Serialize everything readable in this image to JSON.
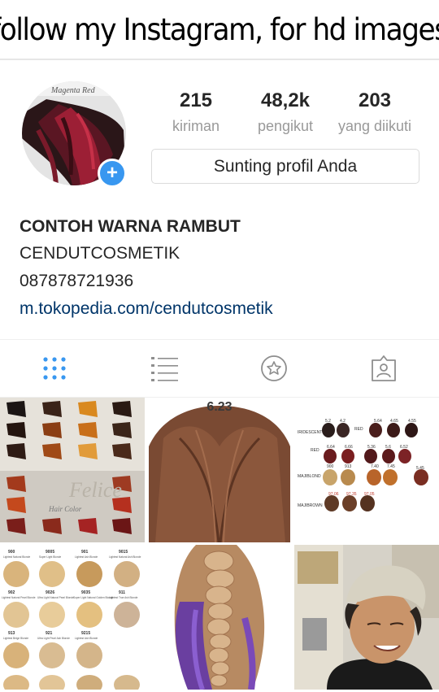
{
  "banner": {
    "text": "follow my Instagram, for hd images"
  },
  "profile": {
    "avatar_label": "Magenta Red",
    "stats": [
      {
        "value": "215",
        "label": "kiriman"
      },
      {
        "value": "48,2k",
        "label": "pengikut"
      },
      {
        "value": "203",
        "label": "yang diikuti"
      }
    ],
    "edit_button": "Sunting profil Anda",
    "bio": {
      "name": "CONTOH WARNA RAMBUT",
      "line1": "CENDUTCOSMETIK",
      "line2": "087878721936",
      "link": "m.tokopedia.com/cendutcosmetik"
    }
  },
  "tabs": [
    {
      "icon": "grid-icon",
      "active": true
    },
    {
      "icon": "list-icon",
      "active": false
    },
    {
      "icon": "star-icon",
      "active": false
    },
    {
      "icon": "tagged-person-icon",
      "active": false
    }
  ],
  "colors": {
    "accent": "#3897f0",
    "link": "#003569",
    "muted": "#999999"
  },
  "posts": {
    "post1": {
      "brand": "Felice",
      "caption": "Hair Color"
    },
    "post2": {
      "shade": "6.23"
    },
    "post3": {
      "rows": [
        "IRIDESCENT",
        "RED",
        "MAJIBLOND",
        "MAJIBROWN"
      ],
      "codes": [
        "5.2",
        "4.2",
        "RED",
        "5.64",
        "4.65",
        "4.55",
        "6.64",
        "6.66",
        "5.36",
        "5.6",
        "6.52",
        "900",
        "913",
        "7.40",
        "7.45",
        "5.45",
        "97.06",
        "97.35",
        "97.05"
      ]
    },
    "post4": {
      "codes": [
        "900",
        "9005",
        "901",
        "9015",
        "902",
        "9026",
        "9035",
        "911",
        "913",
        "921",
        "9215"
      ],
      "names": [
        "Lightest Natural Blonde",
        "Super Light Blonde",
        "Lightest Ash Blonde",
        "Lightest Natural Ash Blonde",
        "Lightest Natural Pearl Blonde",
        "Ultra Light Natural Pearl Blonde",
        "Super Light Natural Golden Blonde",
        "Lightest True Ash Blonde",
        "Lightest Beige Blonde",
        "Ultra Light Pearl Ash Blonde",
        "Lightest Ash Blonde"
      ]
    }
  }
}
